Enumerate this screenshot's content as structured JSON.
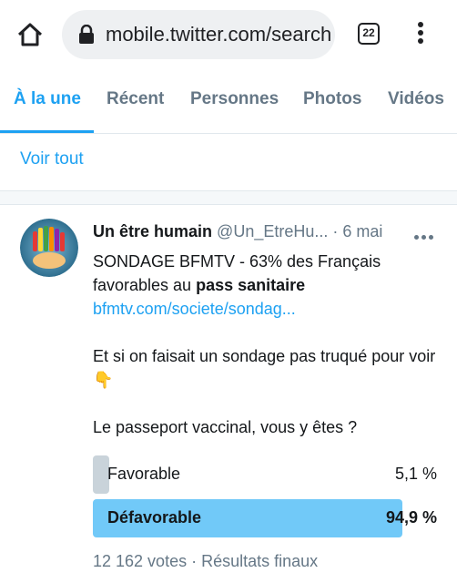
{
  "browser": {
    "url": "mobile.twitter.com/search",
    "tab_count": "22",
    "icons": {
      "home": "home-icon",
      "lock": "lock-icon",
      "menu": "more-vertical-icon"
    }
  },
  "tabs": [
    {
      "label": "À la une",
      "active": true
    },
    {
      "label": "Récent",
      "active": false
    },
    {
      "label": "Personnes",
      "active": false
    },
    {
      "label": "Photos",
      "active": false
    },
    {
      "label": "Vidéos",
      "active": false
    }
  ],
  "see_all": "Voir tout",
  "tweet": {
    "author_name": "Un être humain",
    "author_handle": "@Un_EtreHu...",
    "date_separator": " · ",
    "date": "6 mai",
    "line1_prefix": "SONDAGE BFMTV - 63% des Français favorables au ",
    "line1_bold": "pass sanitaire",
    "link": "bfmtv.com/societe/sondag...",
    "line2": "Et si on faisait un sondage pas truqué pour voir",
    "line2_emoji": "👇",
    "question": "Le passeport vaccinal, vous y êtes ?",
    "poll": {
      "options": [
        {
          "label": "Favorable",
          "percent_label": "5,1 %",
          "percent": 5.1,
          "winner": false
        },
        {
          "label": "Défavorable",
          "percent_label": "94,9 %",
          "percent": 94.9,
          "winner": true
        }
      ],
      "votes": "12 162 votes",
      "footer_separator": " · ",
      "status": "Résultats finaux"
    }
  },
  "colors": {
    "accent": "#1da1f2",
    "poll_winner": "#71c9f8",
    "poll_other": "#c9d3da",
    "muted": "#657786"
  }
}
